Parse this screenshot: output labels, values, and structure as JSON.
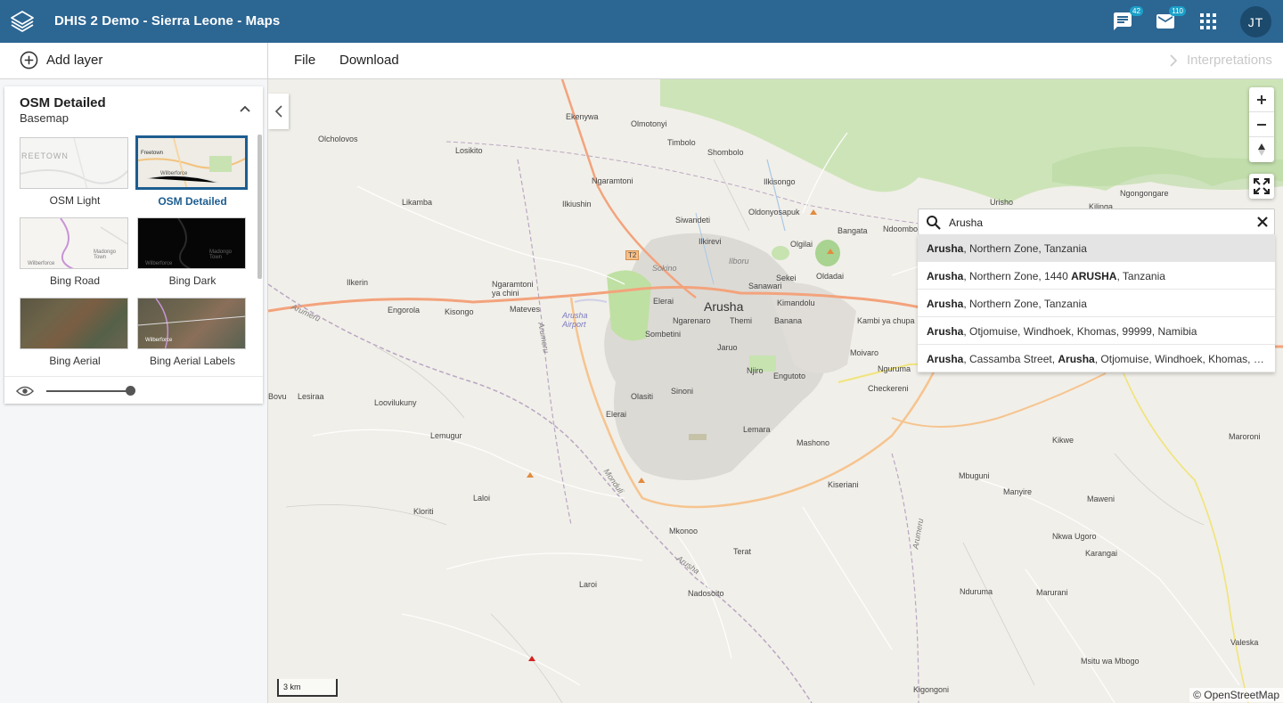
{
  "header": {
    "title": "DHIS 2 Demo - Sierra Leone - Maps",
    "messages_badge": "42",
    "mail_badge": "110",
    "user_initials": "JT"
  },
  "toolbar": {
    "add_layer": "Add layer",
    "file": "File",
    "download": "Download",
    "interpretations": "Interpretations"
  },
  "basemap": {
    "title": "OSM Detailed",
    "subtitle": "Basemap",
    "items": [
      {
        "label": "OSM Light",
        "thumb_text": "REETOWN"
      },
      {
        "label": "OSM Detailed",
        "thumb_text": "Freetown",
        "thumb_text2": "Wilberforce"
      },
      {
        "label": "Bing Road",
        "thumb_text": "Wilberforce",
        "thumb_text2": "Madongo Town"
      },
      {
        "label": "Bing Dark",
        "thumb_text": "Wilberforce",
        "thumb_text2": "Madongo Town"
      },
      {
        "label": "Bing Aerial"
      },
      {
        "label": "Bing Aerial Labels",
        "thumb_text": "Wilberforce"
      }
    ],
    "selected": "OSM Detailed"
  },
  "map": {
    "search_value": "Arusha",
    "results": [
      {
        "bold": "Arusha",
        "rest": ", Northern Zone, Tanzania"
      },
      {
        "bold": "Arusha",
        "rest": ", Northern Zone, 1440 ",
        "bold2": "ARUSHA",
        "rest2": ", Tanzania"
      },
      {
        "bold": "Arusha",
        "rest": ", Northern Zone, Tanzania"
      },
      {
        "bold": "Arusha",
        "rest": ", Otjomuise, Windhoek, Khomas, 99999, Namibia"
      },
      {
        "bold": "Arusha",
        "rest": ", Cassamba Street, ",
        "bold2": "Arusha",
        "rest2": ", Otjomuise, Windhoek, Khomas, 99..."
      }
    ],
    "scale": "3 km",
    "attribution": "© OpenStreetMap",
    "places": {
      "ekenywa": "Ekenywa",
      "olmotonyi": "Olmotonyi",
      "olcholovos": "Olcholovos",
      "timbolo": "Timbolo",
      "shombolo": "Shombolo",
      "losikito": "Losikito",
      "ngaramtoni": "Ngaramtoni",
      "ilkisongo": "Ilkisongo",
      "oldonyosapuk": "Oldonyosapuk",
      "urisho": "Urisho",
      "kilinga": "Kilinga",
      "ngongongare": "Ngongongare",
      "likamba": "Likamba",
      "ilkiushin": "Ilkiushin",
      "siwandeti": "Siwandeti",
      "ilkirevi": "Ilkirevi",
      "olgilai": "Olgilai",
      "bangata": "Bangata",
      "ndoombo": "Ndoombo",
      "sokino": "Sokino",
      "ilboru": "Ilboru",
      "sekei": "Sekei",
      "oldadai": "Oldadai",
      "ilkerin": "Ilkerin",
      "ngaramtoni_ya_chini": "Ngaramtoni ya chini",
      "sanawari": "Sanawari",
      "kimandolu": "Kimandolu",
      "engorola": "Engorola",
      "kisongo": "Kisongo",
      "mateves": "Mateves",
      "elerai": "Elerai",
      "ngarenaro": "Ngarenaro",
      "themi": "Themi",
      "arusha": "Arusha",
      "kambi": "Kambi ya chupa",
      "arusha_airport": "Arusha Airport",
      "sombetini": "Sombetini",
      "banana": "Banana",
      "moivaro": "Moivaro",
      "jaruo": "Jaruo",
      "njiro": "Njiro",
      "engutoto": "Engutoto",
      "nguruma": "Nguruma",
      "lesiraa": "Lesiraa",
      "bovu": "Bovu",
      "loovilukuny": "Loovilukuny",
      "sinoni": "Sinoni",
      "olasiti": "Olasiti",
      "checkereni": "Checkereni",
      "elerai2": "Elerai",
      "lemara": "Lemara",
      "mashono": "Mashono",
      "lemugur": "Lemugur",
      "kikwe": "Kikwe",
      "maroroni": "Maroroni",
      "laloi": "Laloi",
      "kiserian": "Kiseriani",
      "mbuguni": "Mbuguni",
      "manyire": "Manyire",
      "maweni": "Maweni",
      "kloriti": "Kloriti",
      "mkonoo": "Mkonoo",
      "terat": "Terat",
      "nkwa_ugoro": "Nkwa Ugoro",
      "karangai": "Karangai",
      "laroi": "Laroi",
      "nadosoito": "Nadosoito",
      "nduruma": "Nduruma",
      "marurani": "Marurani",
      "valeska": "Valeska",
      "msitu_wa_mbogo": "Msitu wa Mbogo",
      "kigongoni": "Kigongoni",
      "arumeru": "Arumeru",
      "arumeru2": "Arumeru",
      "arumeru3": "Arumeru",
      "monduli": "Monduli",
      "arusha_road": "Arusha",
      "t2": "T2"
    }
  },
  "colors": {
    "header": "#2c6693",
    "accent": "#1d5d90",
    "map_bg": "#f1efe9",
    "park": "#add19e",
    "road": "#f3a37c"
  }
}
